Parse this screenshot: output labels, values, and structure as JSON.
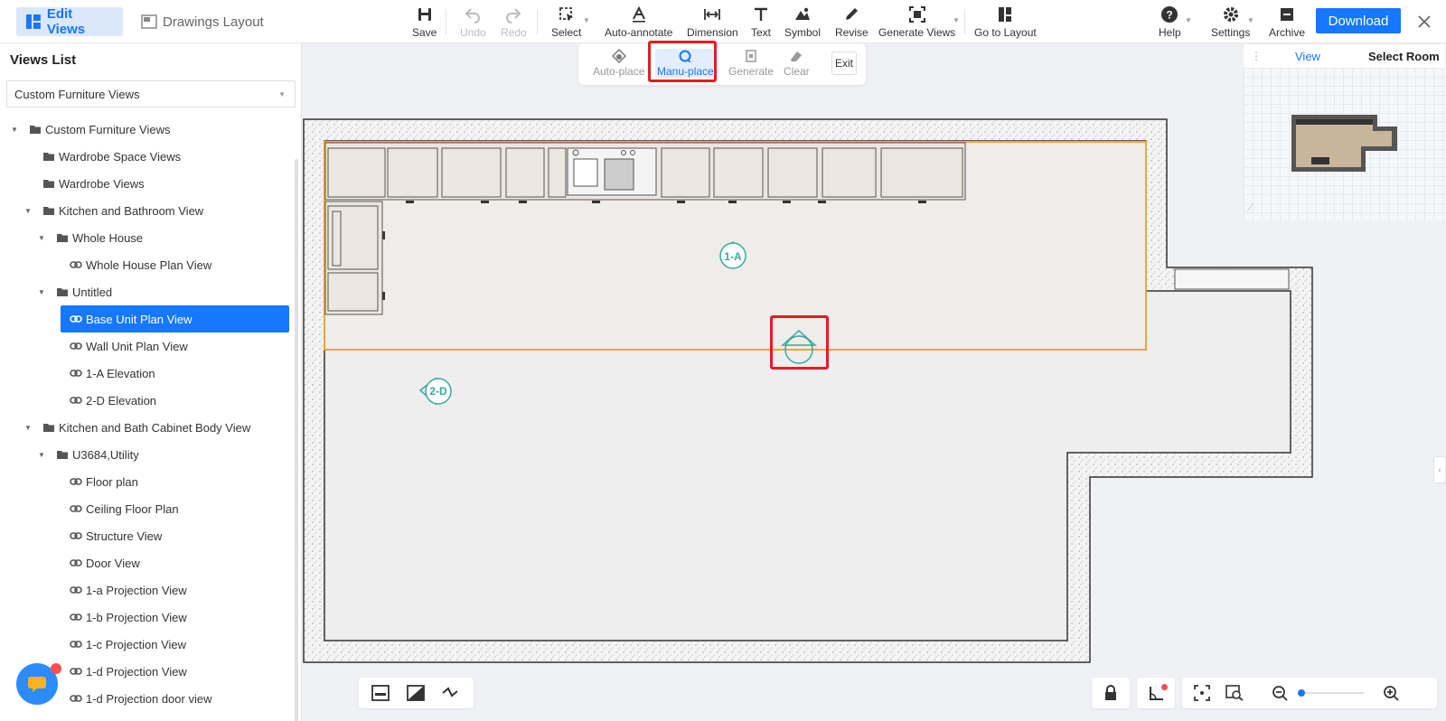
{
  "header": {
    "tab_edit_views": "Edit Views",
    "tab_drawings_layout": "Drawings Layout",
    "tools": {
      "save": "Save",
      "undo": "Undo",
      "redo": "Redo",
      "select": "Select",
      "auto_annotate": "Auto-annotate",
      "dimension": "Dimension",
      "text": "Text",
      "symbol": "Symbol",
      "revise": "Revise",
      "generate_views": "Generate Views",
      "go_to_layout": "Go to Layout"
    },
    "help": "Help",
    "settings": "Settings",
    "archive": "Archive",
    "download": "Download"
  },
  "subtoolbar": {
    "auto_place": "Auto-place",
    "manu_place": "Manu-place",
    "generate": "Generate",
    "clear": "Clear",
    "exit": "Exit"
  },
  "views_list": {
    "title": "Views List",
    "selected_filter": "Custom Furniture Views",
    "tree": [
      {
        "label": "Custom Furniture Views",
        "type": "folder",
        "level": 0,
        "expanded": true
      },
      {
        "label": "Wardrobe Space Views",
        "type": "folder",
        "level": 1
      },
      {
        "label": "Wardrobe Views",
        "type": "folder",
        "level": 1
      },
      {
        "label": "Kitchen and Bathroom View",
        "type": "folder",
        "level": 1,
        "expanded": true
      },
      {
        "label": "Whole House",
        "type": "folder",
        "level": 2,
        "expanded": true
      },
      {
        "label": "Whole House Plan View",
        "type": "view",
        "level": 3
      },
      {
        "label": "Untitled",
        "type": "folder",
        "level": 2,
        "expanded": true
      },
      {
        "label": "Base Unit Plan View",
        "type": "view",
        "level": 3,
        "selected": true
      },
      {
        "label": "Wall Unit Plan View",
        "type": "view",
        "level": 3
      },
      {
        "label": "1-A Elevation",
        "type": "view",
        "level": 3
      },
      {
        "label": "2-D Elevation",
        "type": "view",
        "level": 3
      },
      {
        "label": "Kitchen and Bath Cabinet Body View",
        "type": "folder",
        "level": 1,
        "expanded": true
      },
      {
        "label": "U3684,Utility",
        "type": "folder",
        "level": 2,
        "expanded": true
      },
      {
        "label": "Floor plan",
        "type": "view",
        "level": 3
      },
      {
        "label": "Ceiling Floor Plan",
        "type": "view",
        "level": 3
      },
      {
        "label": "Structure View",
        "type": "view",
        "level": 3
      },
      {
        "label": "Door View",
        "type": "view",
        "level": 3
      },
      {
        "label": "1-a Projection View",
        "type": "view",
        "level": 3
      },
      {
        "label": "1-b Projection View",
        "type": "view",
        "level": 3
      },
      {
        "label": "1-c Projection View",
        "type": "view",
        "level": 3
      },
      {
        "label": "1-d Projection View",
        "type": "view",
        "level": 3
      },
      {
        "label": "1-d Projection door view",
        "type": "view",
        "level": 3
      }
    ]
  },
  "canvas": {
    "marker_1a": "1-A",
    "marker_2d": "2-D"
  },
  "minimap": {
    "tab_view": "View",
    "tab_select_room": "Select Room"
  },
  "colors": {
    "accent": "#1677ff",
    "highlight": "#e51c23",
    "wall_outline": "#333333",
    "selection": "#f5a623",
    "marker": "#3aa7a0"
  },
  "icons": {
    "edit_views": "views-icon",
    "drawings_layout": "layout-icon",
    "chat": "chat-icon"
  }
}
